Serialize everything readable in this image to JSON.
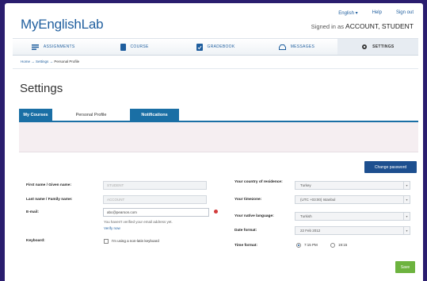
{
  "app": {
    "logo": "MyEnglishLab"
  },
  "toplinks": {
    "language": "English",
    "help": "Help",
    "signout": "Sign out"
  },
  "signed": {
    "prefix": "Signed in as",
    "name": "ACCOUNT, STUDENT"
  },
  "nav": {
    "items": [
      {
        "label": "ASSIGNMENTS",
        "icon": "assignments-icon"
      },
      {
        "label": "COURSE",
        "icon": "course-icon"
      },
      {
        "label": "GRADEBOOK",
        "icon": "gradebook-icon"
      },
      {
        "label": "MESSAGES",
        "icon": "messages-icon"
      },
      {
        "label": "SETTINGS",
        "icon": "gear-icon"
      }
    ]
  },
  "breadcrumb": {
    "home": "Home",
    "sep": "→",
    "settings": "Settings",
    "current": "Personal Profile"
  },
  "page": {
    "title": "Settings"
  },
  "tabs": [
    {
      "label": "My Courses"
    },
    {
      "label": "Personal Profile"
    },
    {
      "label": "Notifications"
    }
  ],
  "buttons": {
    "change_password": "Change password",
    "save": "Save"
  },
  "form": {
    "first_name": {
      "label": "First name / Given name:",
      "value": "STUDENT"
    },
    "last_name": {
      "label": "Last name / Family name:",
      "value": "ACCOUNT"
    },
    "email": {
      "label": "E-mail:",
      "value": "abc@pearson.com",
      "note": "You haven't verified your email address yet.",
      "verify": "Verify now"
    },
    "keyboard": {
      "label": "Keyboard:",
      "checkbox": "I'm using a non-latin keyboard"
    },
    "country": {
      "label": "Your country of residence:",
      "value": "Turkey"
    },
    "timezone": {
      "label": "Your timezone:",
      "value": "(UTC +03:00) Istanbul"
    },
    "language": {
      "label": "Your native language:",
      "value": "Turkish"
    },
    "date_format": {
      "label": "Date format:",
      "value": "22 Feb 2012"
    },
    "time_format": {
      "label": "Time format:",
      "option1": "7:15 PM",
      "option2": "19:15"
    }
  },
  "colors": {
    "brand": "#1f5e9e",
    "tab": "#1a6fa5",
    "save": "#6db33f",
    "button": "#1d4f8f"
  }
}
